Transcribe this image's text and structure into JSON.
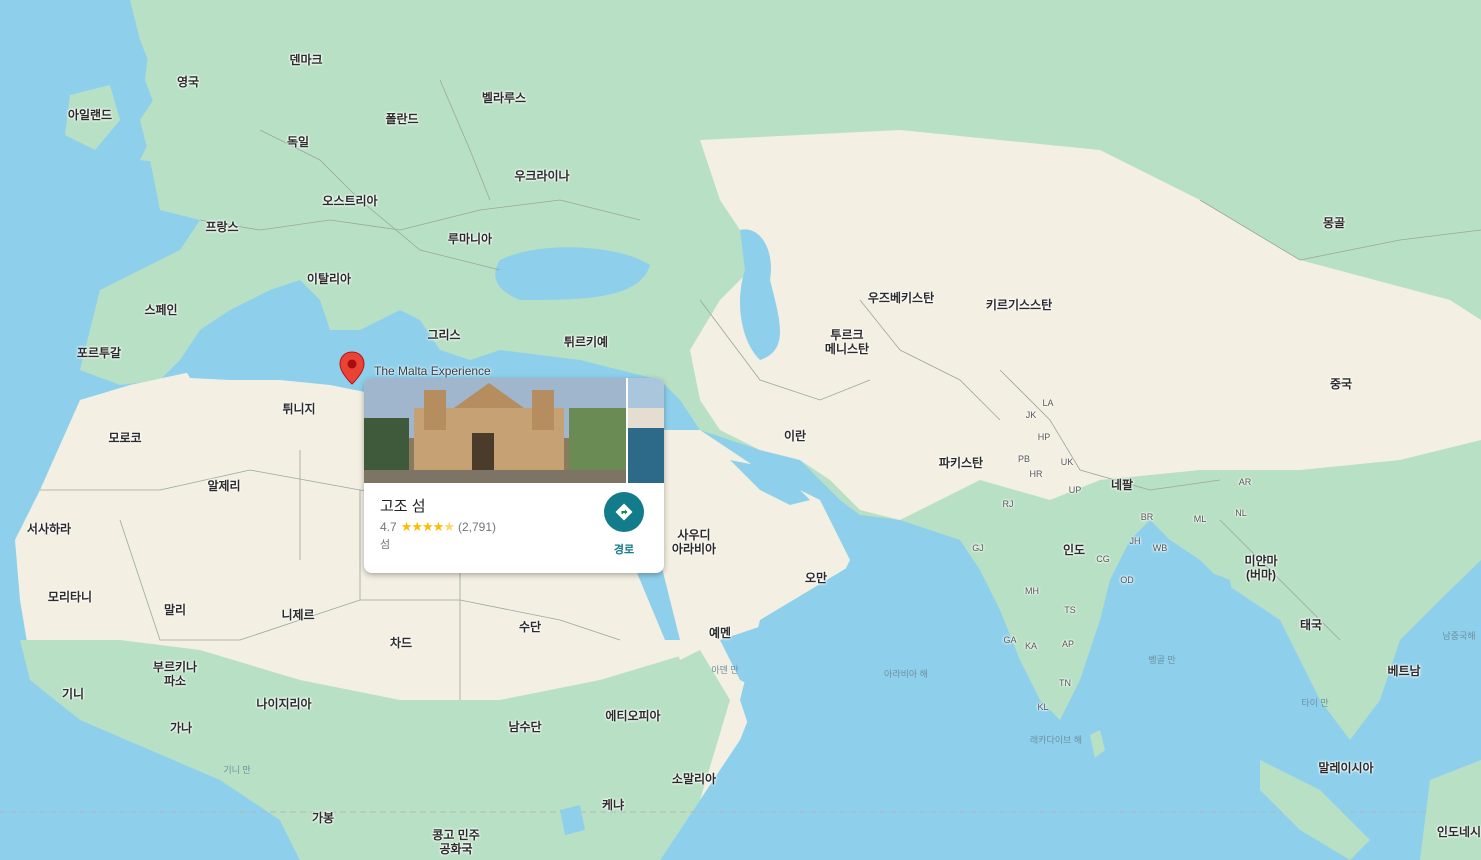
{
  "popup": {
    "place_name": "The Malta Experience",
    "title": "고조 섬",
    "rating": "4.7",
    "reviews": "(2,791)",
    "category": "섬",
    "directions_label": "경로",
    "stars_icon": "star-rating-icon",
    "directions_icon": "directions-icon"
  },
  "colors": {
    "water": "#8ed0ec",
    "land_green": "#b5dfc2",
    "land_dry": "#f4f0e4",
    "accent": "#137c8a",
    "pin": "#ea4335"
  },
  "labels": {
    "denmark": "덴마크",
    "uk": "영국",
    "ireland": "아일랜드",
    "belarus": "벨라루스",
    "poland": "폴란드",
    "germany": "독일",
    "ukraine": "우크라이나",
    "austria": "오스트리아",
    "france": "프랑스",
    "romania": "루마니아",
    "italy": "이탈리아",
    "spain": "스페인",
    "portugal": "포르투갈",
    "greece": "그리스",
    "turkey": "튀르키예",
    "tunisia": "튀니지",
    "morocco": "모로코",
    "algeria": "알제리",
    "wsahara": "서사하라",
    "mauritania": "모리타니",
    "mali": "말리",
    "niger": "니제르",
    "chad": "차드",
    "sudan": "수단",
    "burkina": "부르키나\n파소",
    "guinea": "기니",
    "ghana": "가나",
    "nigeria": "나이지리아",
    "ssudan": "남수단",
    "ethiopia": "에티오피아",
    "somalia": "소말리아",
    "kenya": "케냐",
    "gabon": "가봉",
    "drc": "콩고 민주\n공화국",
    "saudi": "사우디\n아라비아",
    "oman": "오만",
    "yemen": "예멘",
    "iran": "이란",
    "turkmen": "투르크\n메니스탄",
    "uzbek": "우즈베키스탄",
    "kyrgyz": "키르기스스탄",
    "pakistan": "파키스탄",
    "india": "인도",
    "nepal": "네팔",
    "mongolia": "몽골",
    "china": "중국",
    "myanmar": "미얀마\n(버마)",
    "thailand": "태국",
    "vietnam": "베트남",
    "malaysia": "말레이시아",
    "indonesia": "인도네시",
    "arabian_sea": "아라비아 해",
    "aden": "아덴 만",
    "bengal": "벵골 만",
    "laccadive": "래카다이브 해",
    "guinea_gulf": "기니 만",
    "scs": "남중국해",
    "thai_gulf": "타이 만",
    "st_jk": "JK",
    "st_la": "LA",
    "st_hp": "HP",
    "st_pb": "PB",
    "st_uk": "UK",
    "st_hr": "HR",
    "st_up": "UP",
    "st_rj": "RJ",
    "st_br": "BR",
    "st_jh": "JH",
    "st_wb": "WB",
    "st_gj": "GJ",
    "st_cg": "CG",
    "st_od": "OD",
    "st_mh": "MH",
    "st_ts": "TS",
    "st_ga": "GA",
    "st_ka": "KA",
    "st_ap": "AP",
    "st_tn": "TN",
    "st_kl": "KL",
    "st_ar": "AR",
    "st_nl": "NL",
    "st_ml": "ML"
  }
}
